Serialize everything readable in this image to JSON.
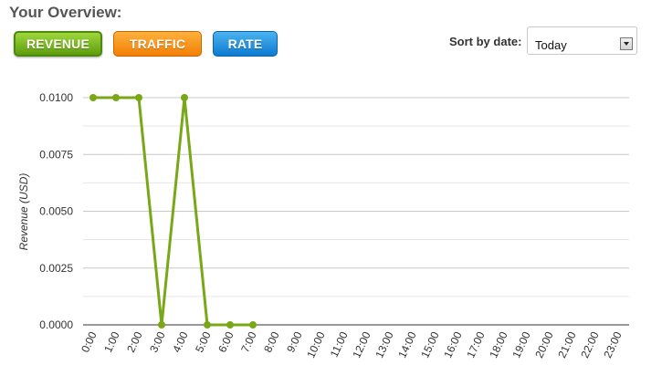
{
  "header": {
    "title": "Your Overview:"
  },
  "metric_tabs": [
    {
      "label": "REVENUE",
      "active": true,
      "color": "#6aaa12"
    },
    {
      "label": "TRAFFIC",
      "active": false,
      "color": "#f58a0a"
    },
    {
      "label": "RATE",
      "active": false,
      "color": "#1785d8"
    }
  ],
  "sort": {
    "label": "Sort by date:",
    "selected": "Today"
  },
  "chart_data": {
    "type": "line",
    "ylabel": "Revenue (USD)",
    "ylim": [
      0,
      0.01
    ],
    "y_ticks": [
      "0.0100",
      "0.0075",
      "0.0050",
      "0.0025",
      "0.0000"
    ],
    "categories": [
      "0:00",
      "1:00",
      "2:00",
      "3:00",
      "4:00",
      "5:00",
      "6:00",
      "7:00",
      "8:00",
      "9:00",
      "10:00",
      "11:00",
      "12:00",
      "13:00",
      "14:00",
      "15:00",
      "16:00",
      "17:00",
      "18:00",
      "19:00",
      "20:00",
      "21:00",
      "22:00",
      "23:00"
    ],
    "series": [
      {
        "color": "#78a818",
        "values": [
          0.01,
          0.01,
          0.01,
          0,
          0.01,
          0,
          0,
          0
        ]
      }
    ],
    "grid": true
  }
}
